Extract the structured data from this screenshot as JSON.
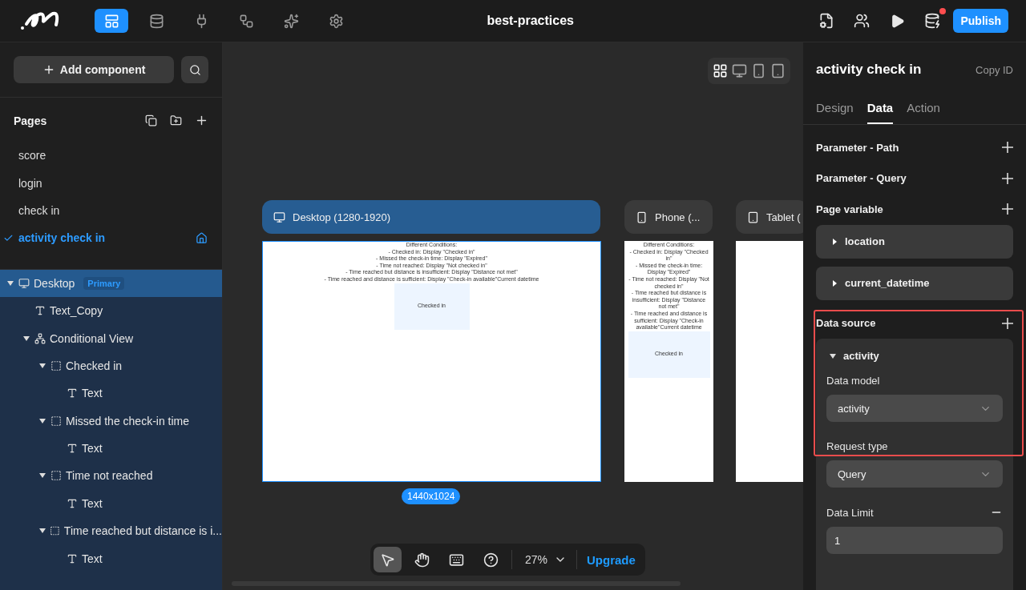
{
  "topbar": {
    "tools": [
      {
        "kind": "pages",
        "selected": true
      },
      {
        "kind": "data",
        "selected": false
      },
      {
        "kind": "api",
        "selected": false
      },
      {
        "kind": "flow",
        "selected": false
      },
      {
        "kind": "ai",
        "selected": false
      },
      {
        "kind": "settings",
        "selected": false
      }
    ],
    "project_title": "best-practices",
    "alert": true,
    "publish": "Publish"
  },
  "sidebar": {
    "add_component": "Add component",
    "pages_title": "Pages",
    "pages": [
      {
        "label": "score",
        "selected": false
      },
      {
        "label": "login",
        "selected": false
      },
      {
        "label": "check in",
        "selected": false
      },
      {
        "label": "activity check in",
        "selected": true
      }
    ],
    "tree": [
      {
        "label": "Desktop",
        "kind": "device",
        "badge": "Primary",
        "selected": true,
        "expanded": true,
        "children": [
          {
            "label": "Text_Copy",
            "kind": "text",
            "selected": false
          },
          {
            "label": "Conditional View",
            "kind": "conditional",
            "selected": false,
            "expanded": true,
            "children": [
              {
                "label": "Checked in",
                "kind": "container",
                "selected": false,
                "expanded": true,
                "children": [
                  {
                    "label": "Text",
                    "kind": "text",
                    "selected": false
                  }
                ]
              },
              {
                "label": "Missed the check-in time",
                "kind": "container",
                "selected": false,
                "expanded": true,
                "children": [
                  {
                    "label": "Text",
                    "kind": "text",
                    "selected": false
                  }
                ]
              },
              {
                "label": "Time not reached",
                "kind": "container",
                "selected": false,
                "expanded": true,
                "children": [
                  {
                    "label": "Text",
                    "kind": "text",
                    "selected": false
                  }
                ]
              },
              {
                "label": "Time reached but distance is i...",
                "kind": "container",
                "selected": false,
                "expanded": true,
                "children": [
                  {
                    "label": "Text",
                    "kind": "text",
                    "selected": false
                  }
                ]
              }
            ]
          }
        ]
      }
    ]
  },
  "canvas": {
    "devices": [
      {
        "kind": "all",
        "selected": true
      },
      {
        "kind": "desktop",
        "selected": false
      },
      {
        "kind": "phone",
        "selected": false
      },
      {
        "kind": "tablet",
        "selected": false
      }
    ],
    "frames": [
      {
        "kind": "desktop",
        "label": "Desktop (1280-1920)",
        "selected": true,
        "size": "1440x1024",
        "lines": [
          "Different Conditions:",
          "- Checked in: Display \"Checked in\"",
          "- Missed the check-in time: Display \"Expired\"",
          "- Time not reached: Display \"Not checked in\"",
          "- Time reached but distance is insufficient: Display \"Distance not met\"",
          "- Time reached and distance is sufficient: Display \"Check-in available\"Current datetime"
        ],
        "box_text": "Checked in"
      },
      {
        "kind": "phone",
        "label": "Phone (...",
        "selected": false,
        "lines": [
          "Different Conditions:",
          "- Checked in: Display \"Checked in\"",
          "- Missed the check-in time: Display \"Expired\"",
          "- Time not reached: Display \"Not checked in\"",
          "- Time reached but distance is insufficient: Display \"Distance not met\"",
          "- Time reached and distance is sufficient: Display \"Check-in available\"Current datetime"
        ],
        "box_text": "Checked in"
      },
      {
        "kind": "tablet",
        "label": "Tablet (",
        "selected": false
      }
    ],
    "tools": [
      {
        "kind": "pointer",
        "selected": true
      },
      {
        "kind": "hand",
        "selected": false
      },
      {
        "kind": "keyboard",
        "selected": false
      },
      {
        "kind": "help",
        "selected": false
      }
    ],
    "zoom": "27%",
    "upgrade": "Upgrade"
  },
  "inspector": {
    "title": "activity check in",
    "copy_id": "Copy ID",
    "tabs": [
      {
        "label": "Design",
        "selected": false
      },
      {
        "label": "Data",
        "selected": true
      },
      {
        "label": "Action",
        "selected": false
      }
    ],
    "params": [
      {
        "label": "Parameter - Path"
      },
      {
        "label": "Parameter - Query"
      }
    ],
    "page_variable": {
      "label": "Page variable",
      "variables": [
        {
          "label": "location",
          "expanded": false
        },
        {
          "label": "current_datetime",
          "expanded": false
        }
      ]
    },
    "data_source": {
      "label": "Data source",
      "highlighted": true,
      "items": [
        {
          "label": "activity",
          "expanded": true,
          "fields": [
            {
              "label": "Data model",
              "kind": "select",
              "value": "activity"
            },
            {
              "label": "Request type",
              "kind": "select",
              "value": "Query"
            },
            {
              "label": "Data Limit",
              "kind": "input",
              "value": "1"
            }
          ]
        }
      ]
    }
  }
}
